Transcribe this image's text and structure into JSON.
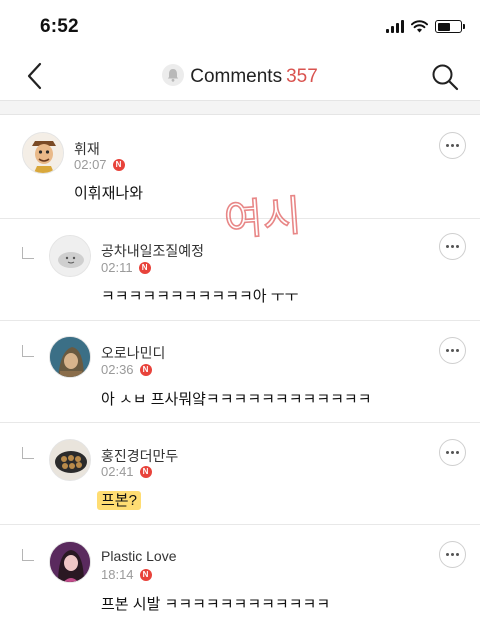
{
  "status_bar": {
    "time": "6:52"
  },
  "nav": {
    "title": "Comments",
    "count": "357"
  },
  "comments": [
    {
      "author": "휘재",
      "time": "02:07",
      "badge": "N",
      "text": "이휘재나와"
    },
    {
      "author": "공차내일조질예정",
      "time": "02:11",
      "badge": "N",
      "text": "ㅋㅋㅋㅋㅋㅋㅋㅋㅋㅋㅋ아 ㅜㅜ"
    },
    {
      "author": "오로나민디",
      "time": "02:36",
      "badge": "N",
      "text": "아 ㅅㅂ 프사뭐얔ㅋㅋㅋㅋㅋㅋㅋㅋㅋㅋㅋㅋ"
    },
    {
      "author": "홍진경더만두",
      "time": "02:41",
      "badge": "N",
      "text": "프본?"
    },
    {
      "author": "Plastic Love",
      "time": "18:14",
      "badge": "N",
      "text": "프본 시발 ㅋㅋㅋㅋㅋㅋㅋㅋㅋㅋㅋㅋ"
    }
  ],
  "annotation": {
    "text": "여시",
    "color": "#e57373"
  },
  "colors": {
    "accent": "#d9534f",
    "badge": "#e8433b",
    "highlight": "#ffd75a"
  }
}
